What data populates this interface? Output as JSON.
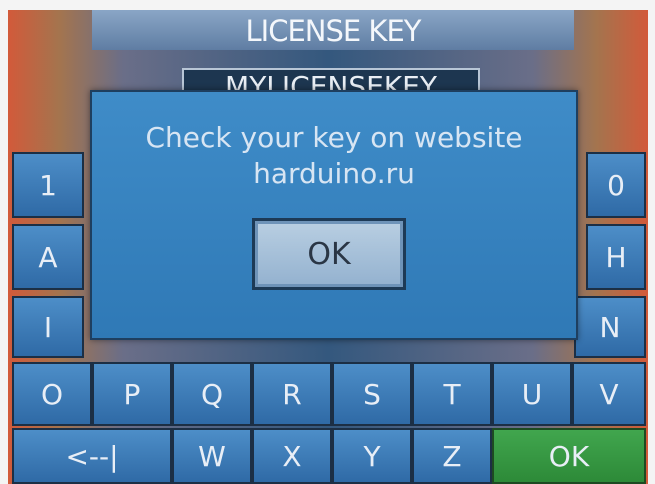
{
  "header": {
    "title": "LICENSE KEY"
  },
  "license_field": {
    "value": "MYLICENSEKEY"
  },
  "keyboard": {
    "row1_left": "1",
    "row1_right": "0",
    "row2_left": "A",
    "row2_right": "H",
    "row3_left": "I",
    "row3_right": "N",
    "row4": [
      "O",
      "P",
      "Q",
      "R",
      "S",
      "T",
      "U",
      "V"
    ],
    "row5": {
      "backspace": "<--|",
      "keys": [
        "W",
        "X",
        "Y",
        "Z"
      ],
      "ok": "OK"
    }
  },
  "dialog": {
    "line1": "Check your key on website",
    "line2": "harduino.ru",
    "ok_label": "OK"
  }
}
